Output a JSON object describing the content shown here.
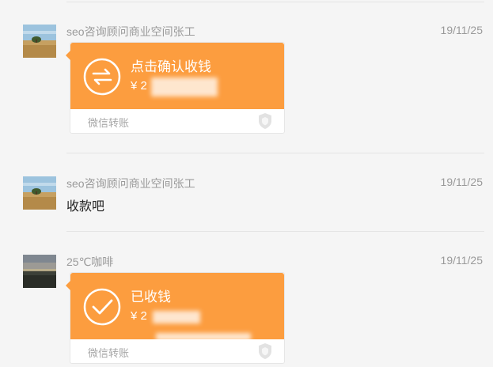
{
  "colors": {
    "background": "#f5f5f5",
    "transfer_card": "#fc9d3f",
    "secondary_text": "#9a9a9a"
  },
  "messages": [
    {
      "sender": "seo咨询顾问商业空间张工",
      "time": "19/11/25",
      "avatar_icon": "field-landscape-avatar",
      "transfer": {
        "icon": "transfer-arrows-icon",
        "title": "点击确认收钱",
        "amount": "¥ 2",
        "source": "微信转账"
      }
    },
    {
      "sender": "seo咨询顾问商业空间张工",
      "time": "19/11/25",
      "avatar_icon": "field-landscape-avatar",
      "text": "收款吧"
    },
    {
      "sender": "25℃咖啡",
      "time": "19/11/25",
      "avatar_icon": "dusk-landscape-avatar",
      "transfer": {
        "icon": "checkmark-icon",
        "title": "已收钱",
        "amount": "¥ 2",
        "source": "微信转账"
      }
    }
  ]
}
